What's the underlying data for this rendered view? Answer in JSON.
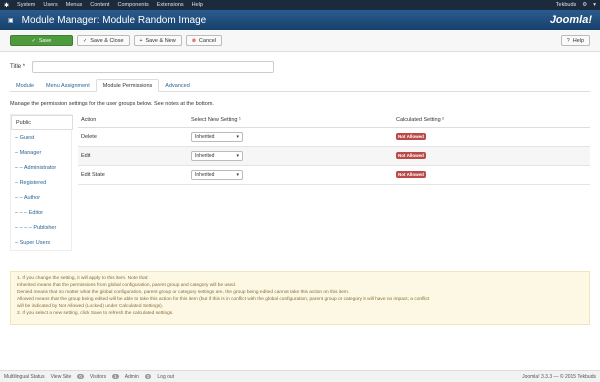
{
  "menubar": {
    "items": [
      "System",
      "Users",
      "Menus",
      "Content",
      "Components",
      "Extensions",
      "Help"
    ],
    "user": "Tekbuds",
    "gear_icon": "gear-icon",
    "user_icon": "user-icon"
  },
  "header": {
    "title": "Module Manager: Module Random Image",
    "logo_text": "Joomla!"
  },
  "toolbar": {
    "save_label": "Save",
    "save_close_label": "Save & Close",
    "save_new_label": "Save & New",
    "cancel_label": "Cancel",
    "help_label": "Help"
  },
  "form": {
    "title_label": "Title *",
    "title_value": ""
  },
  "tabs": [
    "Module",
    "Menu Assignment",
    "Module Permissions",
    "Advanced"
  ],
  "permissions": {
    "note": "Manage the permission settings for the user groups below. See notes at the bottom.",
    "groups": [
      "Public",
      "– Guest",
      "– Manager",
      "– – Administrator",
      "– Registered",
      "– – Author",
      "– – – Editor",
      "– – – – Publisher",
      "– Super Users"
    ],
    "headers": [
      "Action",
      "Select New Setting ¹",
      "Calculated Setting ²"
    ],
    "rows": [
      {
        "action": "Delete",
        "setting": "Inherited",
        "calculated": "Not Allowed"
      },
      {
        "action": "Edit",
        "setting": "Inherited",
        "calculated": "Not Allowed"
      },
      {
        "action": "Edit State",
        "setting": "Inherited",
        "calculated": "Not Allowed"
      }
    ],
    "info_lines": [
      "1. If you change the setting, it will apply to this item. Note that:",
      "Inherited means that the permissions from global configuration, parent group and category will be used.",
      "Denied means that no matter what the global configuration, parent group or category settings are, the group being edited cannot take this action on this item.",
      "Allowed means that the group being edited will be able to take this action for this item (but if this is in conflict with the global configuration, parent group or category it will have no impact; a conflict",
      "will be indicated by Not Allowed (Locked) under Calculated Settings).",
      "2. If you select a new setting, click Save to refresh the calculated settings."
    ]
  },
  "statusbar": {
    "multilingual": "Multilingual Status",
    "view_site": "View Site",
    "visitors_count": "0",
    "visitors": "Visitors",
    "admin_count": "1",
    "admin": "Admin",
    "messages_count": "0",
    "logout": "Log out",
    "version": "Joomla! 3.3.3 — © 2015 Tekbuds"
  }
}
